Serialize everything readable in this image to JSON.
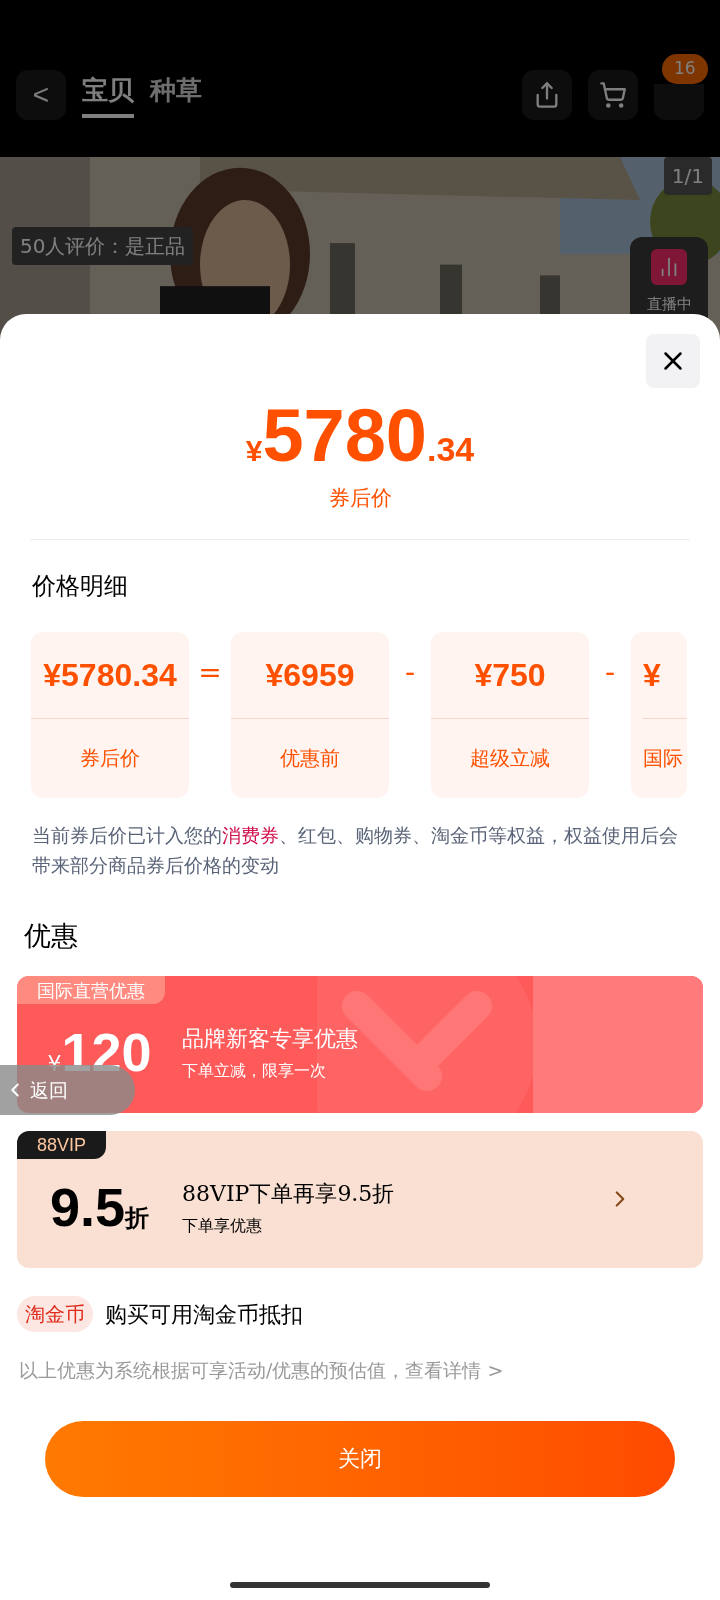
{
  "nav": {
    "back": "<",
    "tabs": [
      {
        "label": "宝贝",
        "selected": true
      },
      {
        "label": "种草",
        "selected": false
      }
    ],
    "badge": "16"
  },
  "photo": {
    "counter": "1/1",
    "review": "50人评价：是正品",
    "live": "直播中"
  },
  "sheet": {
    "currency": "¥",
    "price_int": "5780",
    "price_dec": ".34",
    "price_label": "券后价",
    "breakdown_title": "价格明细",
    "breakdown": [
      {
        "kind": "card",
        "value": "¥5780.34",
        "label": "券后价"
      },
      {
        "kind": "operator",
        "value": "="
      },
      {
        "kind": "card",
        "value": "¥6959",
        "label": "优惠前"
      },
      {
        "kind": "operator",
        "value": "-"
      },
      {
        "kind": "card",
        "value": "¥750",
        "label": "超级立减"
      },
      {
        "kind": "operator",
        "value": "-"
      },
      {
        "kind": "partial",
        "value": "¥",
        "label": "国际"
      }
    ],
    "note": [
      {
        "text": "当前券后价已计入您的",
        "highlight": false
      },
      {
        "text": "消费券",
        "highlight": true
      },
      {
        "text": "、红包、购物券、淘金币等权益，权益使用后会带来部分商品券后价格的变动",
        "highlight": false
      }
    ],
    "offers_title": "优惠",
    "offers": [
      {
        "kind": "red",
        "tag": "国际直营优惠",
        "symbol": "¥",
        "amount": "120",
        "title": "品牌新客专享优惠",
        "subtitle": "下单立减，限享一次"
      },
      {
        "kind": "vip",
        "tag": "88VIP",
        "amount": "9.5",
        "unit": "折",
        "title": "88VIP下单再享9.5折",
        "subtitle": "下单享优惠"
      }
    ],
    "coin_tag": "淘金币",
    "coin_text": "购买可用淘金币抵扣",
    "footnote": "以上优惠为系统根据可享活动/优惠的预估值，查看详情 >",
    "close_label": "关闭",
    "float_back": "返回"
  }
}
